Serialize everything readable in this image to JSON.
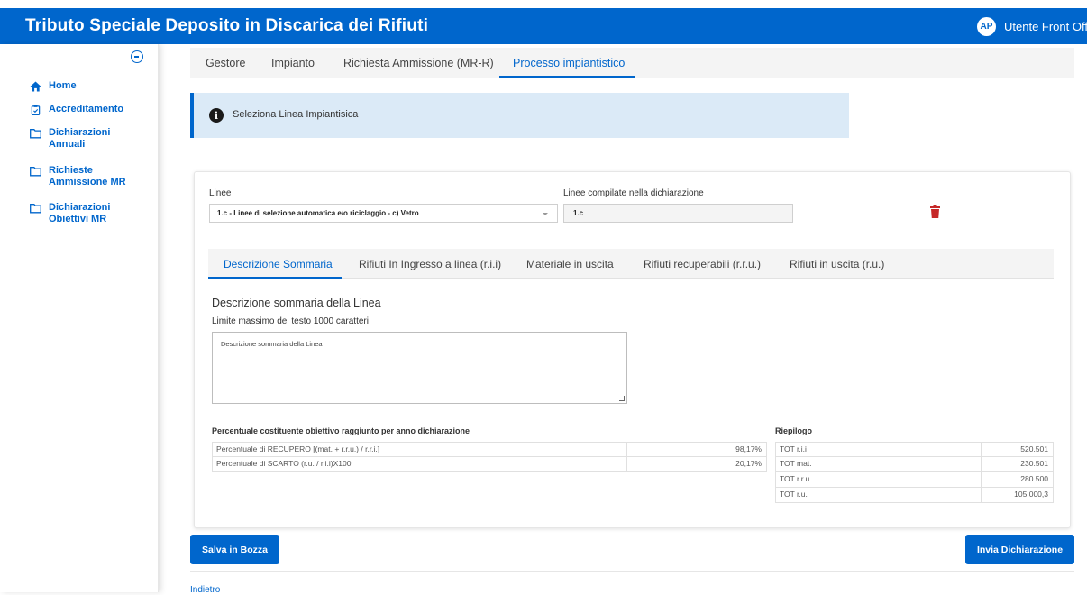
{
  "header": {
    "title": "Tributo Speciale Deposito in Discarica dei Rifiuti",
    "avatar_initials": "AP",
    "user_name": "Utente Front Offic"
  },
  "sidebar": {
    "items": [
      {
        "label": "Home",
        "icon": "home-icon"
      },
      {
        "label": "Accreditamento",
        "icon": "clipboard-icon"
      },
      {
        "label": "Dichiarazioni Annuali",
        "icon": "folder-icon"
      },
      {
        "label": "Richieste Ammissione MR",
        "icon": "folder-icon"
      },
      {
        "label": "Dichiarazioni Obiettivi MR",
        "icon": "folder-icon"
      }
    ]
  },
  "tabs": [
    {
      "label": "Gestore",
      "active": false
    },
    {
      "label": "Impianto",
      "active": false
    },
    {
      "label": "Richiesta Ammissione (MR-R)",
      "active": false
    },
    {
      "label": "Processo impiantistico",
      "active": true
    }
  ],
  "info": {
    "text": "Seleziona Linea Impiantisica"
  },
  "form": {
    "linee_label": "Linee",
    "linee_value": "1.c - Linee di selezione automatica e/o riciclaggio - c) Vetro",
    "compilate_label": "Linee compilate nella dichiarazione",
    "compilate_value": "1.c"
  },
  "subtabs": [
    {
      "label": "Descrizione Sommaria",
      "active": true
    },
    {
      "label": "Rifiuti In Ingresso a linea (r.i.i)",
      "active": false
    },
    {
      "label": "Materiale in uscita",
      "active": false
    },
    {
      "label": "Rifiuti recuperabili (r.r.u.)",
      "active": false
    },
    {
      "label": "Rifiuti in uscita (r.u.)",
      "active": false
    }
  ],
  "description": {
    "title": "Descrizione sommaria della Linea",
    "limit": "Limite massimo del testo 1000 caratteri",
    "value": "Descrizione sommaria della Linea"
  },
  "percentages": {
    "title": "Percentuale costituente obiettivo raggiunto per anno dichiarazione",
    "rows": [
      {
        "label": "Percentuale di RECUPERO [(mat. + r.r.u.) / r.r.i.]",
        "value": "98,17%"
      },
      {
        "label": "Percentuale di SCARTO (r.u. / r.i.i)X100",
        "value": "20,17%"
      }
    ]
  },
  "riepilogo": {
    "title": "Riepilogo",
    "rows": [
      {
        "label": "TOT r.i.i",
        "value": "520.501"
      },
      {
        "label": "TOT mat.",
        "value": "230.501"
      },
      {
        "label": "TOT r.r.u.",
        "value": "280.500"
      },
      {
        "label": "TOT r.u.",
        "value": "105.000,3"
      }
    ]
  },
  "actions": {
    "draft_label": "Salva in Bozza",
    "submit_label": "Invia Dichiarazione",
    "back_label": "Indietro"
  },
  "colors": {
    "primary": "#0066cc",
    "info_bg": "#dbeaf7",
    "danger": "#c62828"
  }
}
